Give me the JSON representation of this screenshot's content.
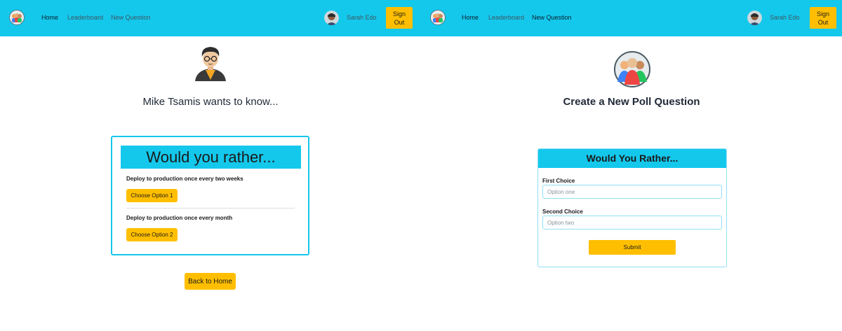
{
  "navbar": {
    "links": [
      "Home",
      "Leaderboard",
      "New Question"
    ],
    "user_name": "Sarah Edo",
    "signout_label": "Sign\nOut",
    "color": "#14c8ec",
    "accent": "#ffbf00"
  },
  "icons": {
    "logo": "group-logo-icon",
    "user": "user-avatar-icon",
    "author": "author-avatar-icon",
    "group": "group-avatar-icon"
  },
  "poll": {
    "heading": "Mike Tsamis wants to know...",
    "card_title": "Would you rather...",
    "options": [
      {
        "text": "Deploy to production once every two weeks",
        "button": "Choose Option 1"
      },
      {
        "text": "Deploy to production once every month",
        "button": "Choose Option 2"
      }
    ],
    "back_label": "Back to Home"
  },
  "new_question": {
    "title": "Create a New Poll Question",
    "form_title": "Would You Rather...",
    "first_label": "First Choice",
    "first_placeholder": "Option one",
    "second_label": "Second Choice",
    "second_placeholder": "Option two",
    "submit_label": "Submit"
  }
}
